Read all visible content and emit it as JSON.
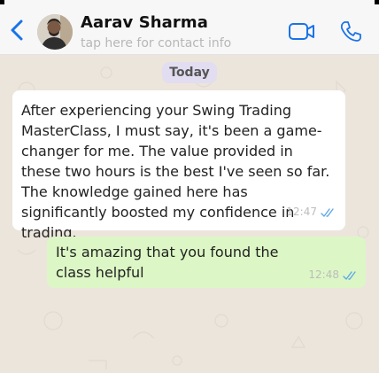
{
  "header": {
    "contact_name": "Aarav Sharma",
    "subtitle": "tap here for contact info",
    "icons": {
      "back": "chevron-left-icon",
      "video": "video-camera-icon",
      "call": "phone-icon"
    },
    "accent_color": "#1a73e8"
  },
  "chat": {
    "date_label": "Today",
    "messages": [
      {
        "direction": "incoming",
        "text": "After experiencing your Swing Trading MasterClass, I must say, it's been a game-changer for me. The value provided in these two hours is the best I've seen so far. The knowledge gained here has significantly boosted my confidence in trading.",
        "time": "12:47",
        "status": "read"
      },
      {
        "direction": "outgoing",
        "text": "It's amazing that you found the class helpful",
        "time": "12:48",
        "status": "read"
      }
    ]
  },
  "colors": {
    "incoming_bubble": "#ffffff",
    "outgoing_bubble": "#dcf7c5",
    "date_pill": "#e2ddf0",
    "read_ticks": "#5fa8e8"
  }
}
